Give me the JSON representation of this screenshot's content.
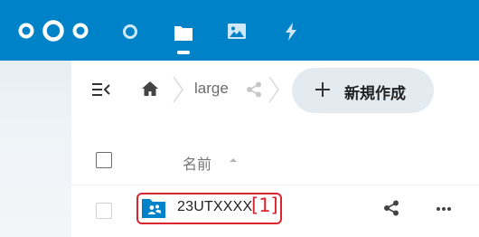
{
  "nav": {
    "logo_icon": "nextcloud-logo-icon",
    "items": [
      {
        "icon": "dashboard-icon"
      },
      {
        "icon": "files-icon",
        "active": true
      },
      {
        "icon": "photos-icon"
      },
      {
        "icon": "activity-icon"
      }
    ],
    "color": "#0082c9"
  },
  "toolbar": {
    "menu_icon": "menu-toggle-icon",
    "breadcrumb": {
      "home_icon": "home-icon",
      "folder": "large",
      "share_icon": "share-icon"
    },
    "new_button": {
      "icon": "plus-icon",
      "label": "新規作成"
    }
  },
  "file_list": {
    "header": {
      "name_label": "名前",
      "sort_icon": "sort-ascending-icon"
    },
    "rows": [
      {
        "icon": "shared-folder-icon",
        "name": "23UTXXXX",
        "annotation": "[1]",
        "share_icon": "share-icon",
        "more_icon": "more-actions-icon"
      }
    ]
  },
  "colors": {
    "brand": "#0082c9",
    "annotation": "#d9262e",
    "new_button_bg": "#e3ebf1"
  }
}
